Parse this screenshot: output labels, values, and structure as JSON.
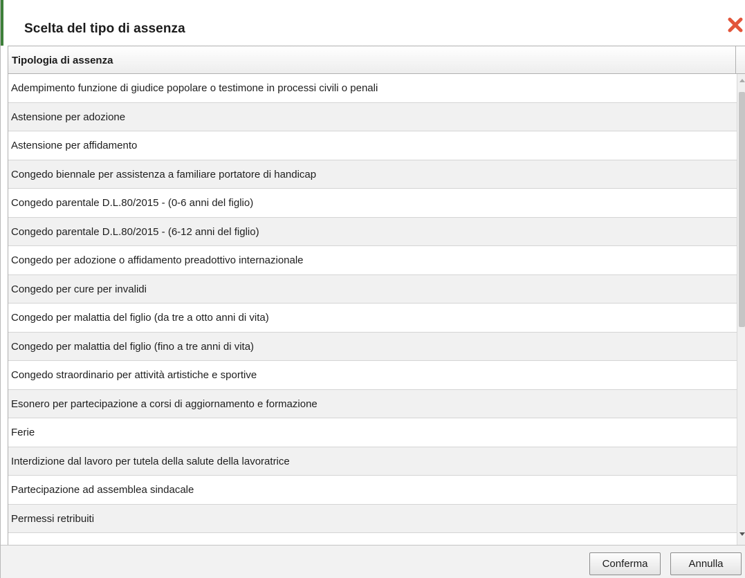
{
  "dialog": {
    "title": "Scelta del tipo di assenza",
    "close_icon": "close-x-icon",
    "accent_color": "#3e7f3a",
    "close_color": "#e2553b"
  },
  "table": {
    "column_header": "Tipologia di assenza",
    "rows": [
      "Adempimento funzione di giudice popolare o testimone in processi civili o penali",
      "Astensione per adozione",
      "Astensione per affidamento",
      "Congedo biennale per assistenza a familiare portatore di handicap",
      "Congedo parentale D.L.80/2015 - (0-6 anni del figlio)",
      "Congedo parentale D.L.80/2015 - (6-12 anni del figlio)",
      "Congedo per adozione o affidamento preadottivo internazionale",
      "Congedo per cure per invalidi",
      "Congedo per malattia del figlio (da tre a otto anni di vita)",
      "Congedo per malattia del figlio (fino a tre anni di vita)",
      "Congedo straordinario per attività artistiche e sportive",
      "Esonero per partecipazione a corsi di aggiornamento e formazione",
      "Ferie",
      "Interdizione dal lavoro per tutela della salute della lavoratrice",
      "Partecipazione ad assemblea sindacale",
      "Permessi retribuiti"
    ]
  },
  "footer": {
    "confirm_label": "Conferma",
    "cancel_label": "Annulla"
  }
}
